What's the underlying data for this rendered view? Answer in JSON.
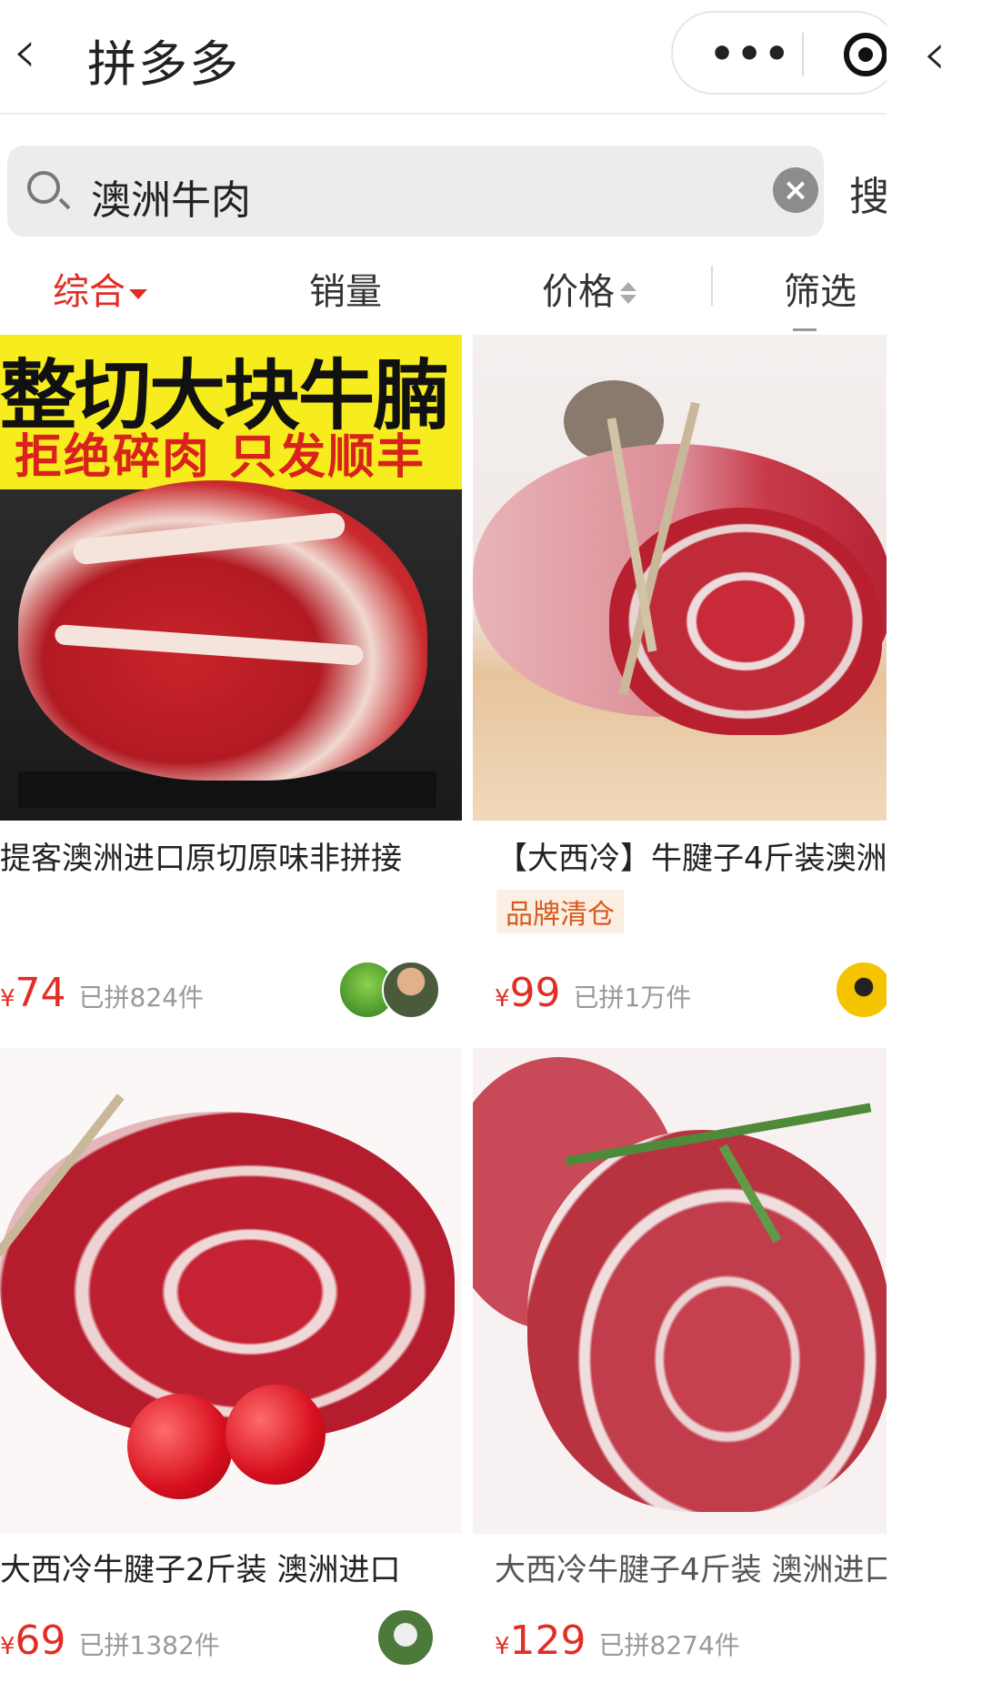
{
  "header": {
    "title": "拼多多",
    "back_icon": "chevron-left-icon",
    "more_label": "•••",
    "close_icon": "target-icon"
  },
  "search": {
    "query": "澳洲牛肉",
    "button_label": "搜"
  },
  "sort_tabs": [
    {
      "label": "综合"
    },
    {
      "label": "销量"
    },
    {
      "label": "价格"
    },
    {
      "label": "筛选"
    }
  ],
  "products": [
    {
      "banner_line1": "整切大块牛腩",
      "banner_line2": "拒绝碎肉 只发顺丰",
      "name": "提客澳洲进口原切原味非拼接",
      "currency": "¥",
      "price": "74",
      "sold": "已拼824件"
    },
    {
      "name": "【大西冷】牛腱子4斤装澳洲",
      "badge": "品牌清仓",
      "currency": "¥",
      "price": "99",
      "sold": "已拼1万件"
    },
    {
      "name": "大西冷牛腱子2斤装 澳洲进口",
      "currency": "¥",
      "price": "69",
      "sold": "已拼1382件"
    },
    {
      "name": "大西冷牛腱子4斤装 澳洲进口",
      "currency": "¥",
      "price": "129",
      "sold": "已拼8274件"
    }
  ],
  "colors": {
    "accent": "#e02e24",
    "badge_text": "#d45a1e",
    "badge_bg": "#fdeee3"
  }
}
